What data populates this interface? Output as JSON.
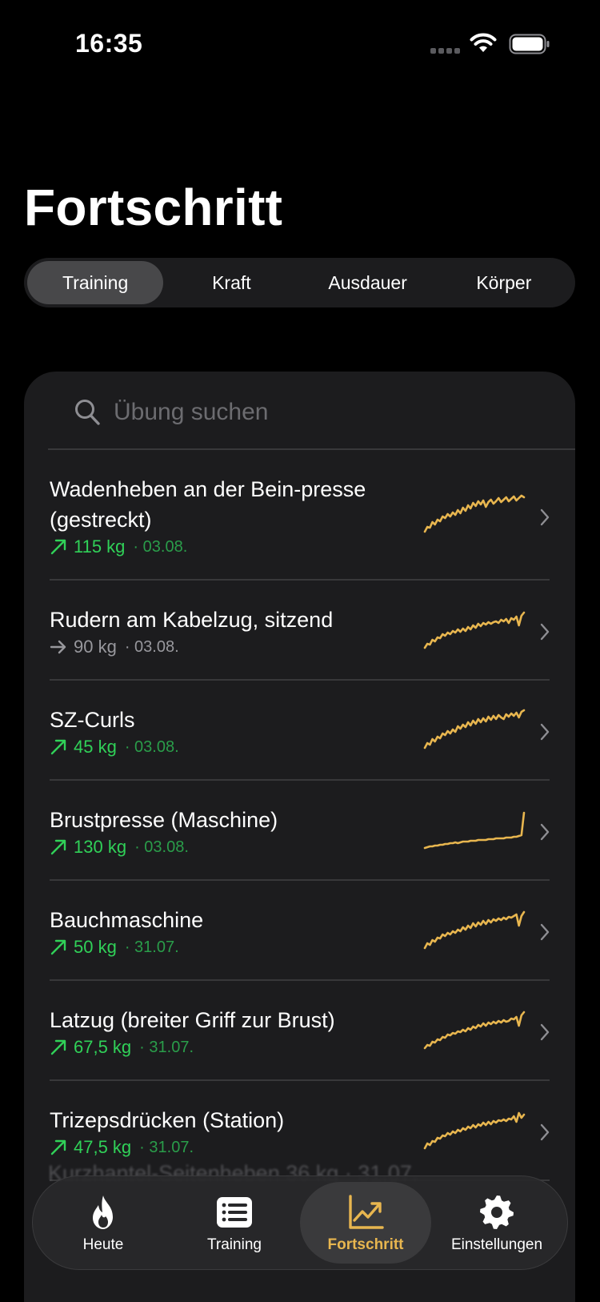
{
  "status_bar": {
    "time": "16:35"
  },
  "page": {
    "title": "Fortschritt"
  },
  "segments": [
    {
      "label": "Training",
      "active": true
    },
    {
      "label": "Kraft",
      "active": false
    },
    {
      "label": "Ausdauer",
      "active": false
    },
    {
      "label": "Körper",
      "active": false
    }
  ],
  "search": {
    "placeholder": "Übung suchen",
    "value": ""
  },
  "exercises": [
    {
      "name": "Wadenheben an der Bein-presse (gestreckt)",
      "trend": "up",
      "value": "115 kg",
      "date": "· 03.08."
    },
    {
      "name": "Rudern am Kabelzug, sitzend",
      "trend": "flat",
      "value": "90 kg",
      "date": "· 03.08."
    },
    {
      "name": "SZ-Curls",
      "trend": "up",
      "value": "45 kg",
      "date": "· 03.08."
    },
    {
      "name": "Brustpresse (Maschine)",
      "trend": "up",
      "value": "130 kg",
      "date": "· 03.08."
    },
    {
      "name": "Bauchmaschine",
      "trend": "up",
      "value": "50 kg",
      "date": "· 31.07."
    },
    {
      "name": "Latzug (breiter Griff zur Brust)",
      "trend": "up",
      "value": "67,5 kg",
      "date": "· 31.07."
    },
    {
      "name": "Trizepsdrücken (Station)",
      "trend": "up",
      "value": "47,5 kg",
      "date": "· 31.07."
    }
  ],
  "partially_hidden_row": {
    "name": "Kurzhantel-Seitenheben",
    "value": "36 kg",
    "date": "· 31.07."
  },
  "tab_bar": {
    "tabs": [
      {
        "label": "Heute",
        "icon": "flame-icon",
        "active": false
      },
      {
        "label": "Training",
        "icon": "list-icon",
        "active": false
      },
      {
        "label": "Fortschritt",
        "icon": "chart-icon",
        "active": true
      },
      {
        "label": "Einstellungen",
        "icon": "gear-icon",
        "active": false
      }
    ]
  },
  "colors": {
    "accent": "#e8b64f",
    "up": "#30d158",
    "background": "#000000",
    "card": "#1c1c1e"
  }
}
